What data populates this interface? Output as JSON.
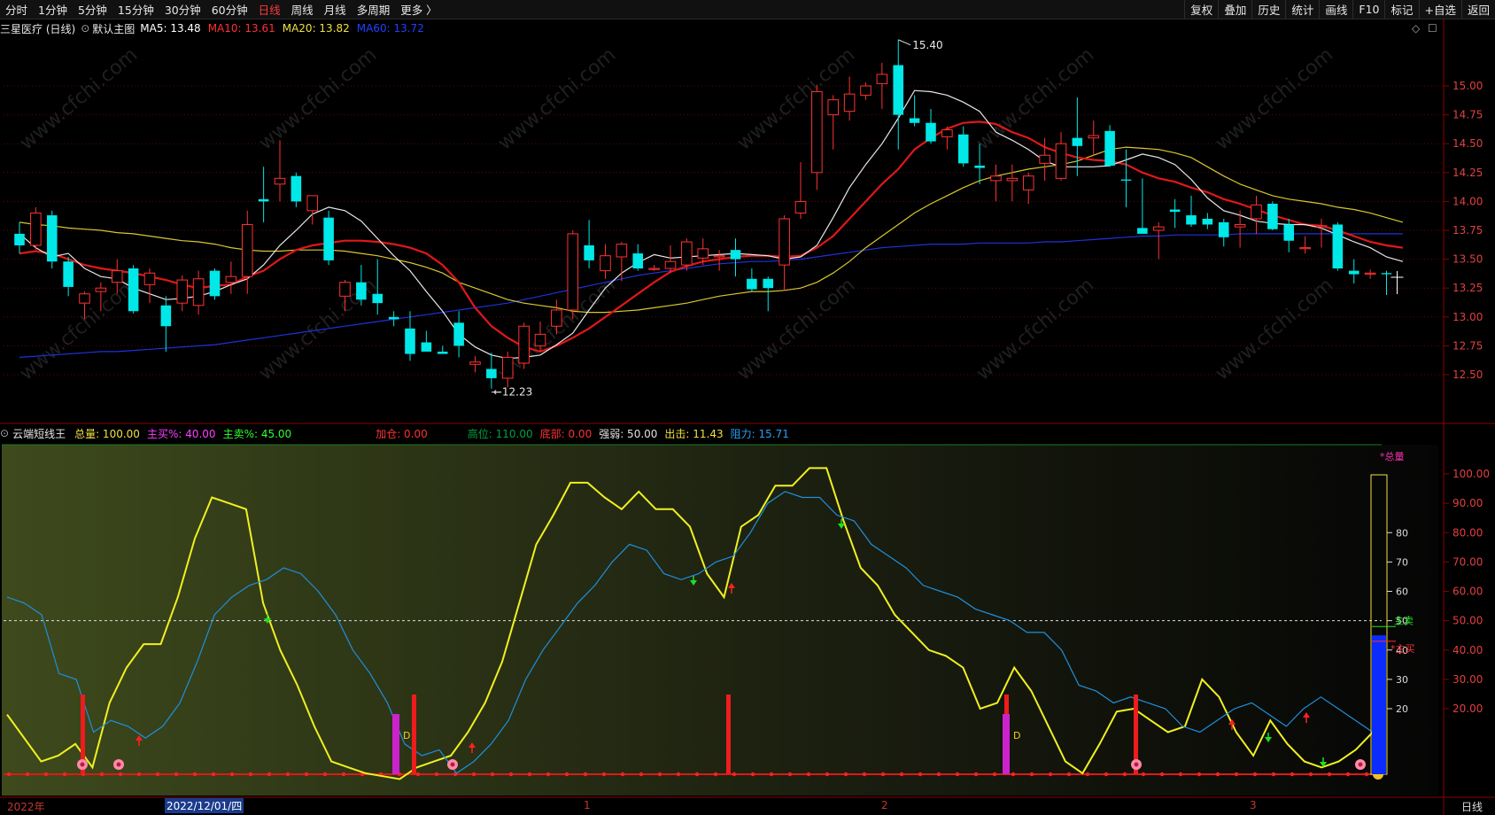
{
  "toolbar": {
    "left": [
      "分时",
      "1分钟",
      "5分钟",
      "15分钟",
      "30分钟",
      "60分钟",
      "日线",
      "周线",
      "月线",
      "多周期",
      "更多 〉"
    ],
    "active": "日线",
    "right": [
      "复权",
      "叠加",
      "历史",
      "统计",
      "画线",
      "F10",
      "标记",
      "+自选",
      "返回"
    ]
  },
  "main": {
    "stock": "三星医疗 (日线)",
    "template": "默认主图",
    "ma": [
      {
        "label": "MA5: 13.48",
        "color": "#ffffff"
      },
      {
        "label": "MA10: 13.61",
        "color": "#ff3030"
      },
      {
        "label": "MA20: 13.82",
        "color": "#f0e040"
      },
      {
        "label": "MA60: 13.72",
        "color": "#2040ff"
      }
    ],
    "high_label": "15.40",
    "low_label": "12.23",
    "price_ticks": [
      "15.00",
      "14.75",
      "14.50",
      "14.25",
      "14.00",
      "13.75",
      "13.50",
      "13.25",
      "13.00",
      "12.75",
      "12.50"
    ]
  },
  "indicator": {
    "name": "云端短线王",
    "items": [
      {
        "text": "总量: 100.00",
        "color": "#f0e040"
      },
      {
        "text": "主买%: 40.00",
        "color": "#ff3cff"
      },
      {
        "text": "主卖%: 45.00",
        "color": "#30ff30"
      },
      {
        "text": "加仓: 0.00",
        "color": "#ff3030"
      },
      {
        "text": "高位: 110.00",
        "color": "#00a040"
      },
      {
        "text": "底部: 0.00",
        "color": "#ff3030"
      },
      {
        "text": "强弱: 50.00",
        "color": "#e0e0e0"
      },
      {
        "text": "出击: 11.43",
        "color": "#f0e040"
      },
      {
        "text": "阻力: 15.71",
        "color": "#2a9df4"
      }
    ],
    "ticks": [
      "100.00",
      "90.00",
      "80.00",
      "70.00",
      "60.00",
      "50.00",
      "40.00",
      "30.00",
      "20.00"
    ],
    "bar_ticks": [
      "80",
      "70",
      "60",
      "50",
      "40",
      "30",
      "20"
    ],
    "bar_labels": {
      "total": "*总量",
      "sell": "主卖",
      "buy": "*主买"
    },
    "d_label": "D"
  },
  "dates": {
    "start": "2022年",
    "cursor": "2022/12/01/四",
    "m1": "1",
    "m2": "2",
    "m3": "3"
  },
  "period_tab": "日线",
  "watermark": "www.cfchi.com",
  "chart_data": {
    "type": "candlestick",
    "candles": [
      [
        13.72,
        13.82,
        13.55,
        13.62
      ],
      [
        13.62,
        13.95,
        13.58,
        13.9
      ],
      [
        13.88,
        13.92,
        13.42,
        13.48
      ],
      [
        13.48,
        13.52,
        13.18,
        13.26
      ],
      [
        13.12,
        13.22,
        12.98,
        13.2
      ],
      [
        13.22,
        13.3,
        13.05,
        13.25
      ],
      [
        13.3,
        13.5,
        13.2,
        13.4
      ],
      [
        13.42,
        13.45,
        13.03,
        13.05
      ],
      [
        13.28,
        13.42,
        13.12,
        13.38
      ],
      [
        13.1,
        13.18,
        12.7,
        12.92
      ],
      [
        13.12,
        13.36,
        13.05,
        13.32
      ],
      [
        13.1,
        13.4,
        13.02,
        13.33
      ],
      [
        13.4,
        13.42,
        13.15,
        13.18
      ],
      [
        13.3,
        13.48,
        13.2,
        13.35
      ],
      [
        13.35,
        13.92,
        13.2,
        13.8
      ],
      [
        14.02,
        14.3,
        13.82,
        14.0
      ],
      [
        14.15,
        14.53,
        14.0,
        14.2
      ],
      [
        14.22,
        14.25,
        13.95,
        14.0
      ],
      [
        13.92,
        14.05,
        13.8,
        14.05
      ],
      [
        13.86,
        13.92,
        13.45,
        13.49
      ],
      [
        13.18,
        13.32,
        13.05,
        13.3
      ],
      [
        13.3,
        13.45,
        13.1,
        13.15
      ],
      [
        13.2,
        13.5,
        13.02,
        13.12
      ],
      [
        13.0,
        13.05,
        12.92,
        12.98
      ],
      [
        12.9,
        13.05,
        12.62,
        12.68
      ],
      [
        12.78,
        12.88,
        12.71,
        12.7
      ],
      [
        12.7,
        12.75,
        12.69,
        12.68
      ],
      [
        12.95,
        13.05,
        12.65,
        12.75
      ],
      [
        12.59,
        12.66,
        12.52,
        12.61
      ],
      [
        12.55,
        12.69,
        12.38,
        12.47
      ],
      [
        12.47,
        12.7,
        12.39,
        12.65
      ],
      [
        12.6,
        12.95,
        12.55,
        12.92
      ],
      [
        12.75,
        12.96,
        12.7,
        12.85
      ],
      [
        12.92,
        13.15,
        12.85,
        13.06
      ],
      [
        13.06,
        13.75,
        12.98,
        13.72
      ],
      [
        13.62,
        13.84,
        13.42,
        13.49
      ],
      [
        13.4,
        13.63,
        13.33,
        13.53
      ],
      [
        13.52,
        13.65,
        13.31,
        13.63
      ],
      [
        13.55,
        13.63,
        13.4,
        13.42
      ],
      [
        13.42,
        13.45,
        13.4,
        13.42
      ],
      [
        13.42,
        13.62,
        13.38,
        13.48
      ],
      [
        13.45,
        13.68,
        13.4,
        13.65
      ],
      [
        13.51,
        13.68,
        13.45,
        13.59
      ],
      [
        13.52,
        13.58,
        13.4,
        13.53
      ],
      [
        13.58,
        13.68,
        13.35,
        13.5
      ],
      [
        13.33,
        13.42,
        13.22,
        13.24
      ],
      [
        13.33,
        13.35,
        13.05,
        13.25
      ],
      [
        13.45,
        13.88,
        13.23,
        13.85
      ],
      [
        13.9,
        14.34,
        13.85,
        14.0
      ],
      [
        14.25,
        15.01,
        14.1,
        14.95
      ],
      [
        14.75,
        14.92,
        14.45,
        14.88
      ],
      [
        14.78,
        15.08,
        14.7,
        14.93
      ],
      [
        14.92,
        15.03,
        14.88,
        15.0
      ],
      [
        15.02,
        15.2,
        14.8,
        15.1
      ],
      [
        15.18,
        15.4,
        14.45,
        14.75
      ],
      [
        14.72,
        14.92,
        14.65,
        14.68
      ],
      [
        14.68,
        14.8,
        14.5,
        14.52
      ],
      [
        14.56,
        14.65,
        14.45,
        14.62
      ],
      [
        14.58,
        14.65,
        14.3,
        14.33
      ],
      [
        14.31,
        14.5,
        14.15,
        14.29
      ],
      [
        14.18,
        14.32,
        14.0,
        14.22
      ],
      [
        14.18,
        14.32,
        14.0,
        14.2
      ],
      [
        14.1,
        14.25,
        13.98,
        14.22
      ],
      [
        14.33,
        14.55,
        14.18,
        14.4
      ],
      [
        14.2,
        14.6,
        14.18,
        14.5
      ],
      [
        14.55,
        14.9,
        14.22,
        14.48
      ],
      [
        14.55,
        14.7,
        14.4,
        14.57
      ],
      [
        14.61,
        14.66,
        14.3,
        14.31
      ],
      [
        14.19,
        14.45,
        13.95,
        14.18
      ],
      [
        13.77,
        14.2,
        13.75,
        13.72
      ],
      [
        13.75,
        13.82,
        13.5,
        13.78
      ],
      [
        13.93,
        14.02,
        13.77,
        13.91
      ],
      [
        13.88,
        14.05,
        13.78,
        13.8
      ],
      [
        13.85,
        13.9,
        13.76,
        13.8
      ],
      [
        13.82,
        13.85,
        13.61,
        13.69
      ],
      [
        13.78,
        13.92,
        13.6,
        13.8
      ],
      [
        13.85,
        14.05,
        13.72,
        13.97
      ],
      [
        13.98,
        14.0,
        13.75,
        13.76
      ],
      [
        13.8,
        13.85,
        13.56,
        13.66
      ],
      [
        13.6,
        13.7,
        13.55,
        13.6
      ],
      [
        13.78,
        13.85,
        13.6,
        13.79
      ],
      [
        13.8,
        13.82,
        13.4,
        13.42
      ],
      [
        13.4,
        13.5,
        13.29,
        13.37
      ],
      [
        13.38,
        13.41,
        13.33,
        13.38
      ],
      [
        13.38,
        13.4,
        13.19,
        13.37
      ]
    ],
    "ma5": [
      13.72,
      13.6,
      13.52,
      13.55,
      13.42,
      13.35,
      13.33,
      13.25,
      13.2,
      13.15,
      13.16,
      13.18,
      13.22,
      13.28,
      13.33,
      13.45,
      13.62,
      13.75,
      13.89,
      13.95,
      13.92,
      13.83,
      13.68,
      13.53,
      13.4,
      13.22,
      13.05,
      12.85,
      12.74,
      12.67,
      12.64,
      12.65,
      12.67,
      12.76,
      12.86,
      13.06,
      13.25,
      13.38,
      13.47,
      13.54,
      13.51,
      13.52,
      13.53,
      13.54,
      13.55,
      13.54,
      13.53,
      13.5,
      13.52,
      13.62,
      13.86,
      14.12,
      14.32,
      14.5,
      14.72,
      14.96,
      14.95,
      14.92,
      14.86,
      14.78,
      14.6,
      14.53,
      14.45,
      14.35,
      14.3,
      14.3,
      14.3,
      14.31,
      14.36,
      14.41,
      14.38,
      14.32,
      14.19,
      14.03,
      13.92,
      13.88,
      13.83,
      13.81,
      13.8,
      13.8,
      13.77,
      13.71,
      13.65,
      13.6,
      13.52,
      13.48
    ],
    "ma10": [
      13.55,
      13.57,
      13.55,
      13.5,
      13.45,
      13.42,
      13.4,
      13.38,
      13.35,
      13.32,
      13.28,
      13.25,
      13.27,
      13.28,
      13.35,
      13.4,
      13.5,
      13.58,
      13.62,
      13.64,
      13.66,
      13.66,
      13.65,
      13.63,
      13.6,
      13.55,
      13.45,
      13.3,
      13.08,
      12.92,
      12.82,
      12.74,
      12.7,
      12.75,
      12.82,
      12.9,
      13.0,
      13.1,
      13.2,
      13.3,
      13.39,
      13.44,
      13.48,
      13.5,
      13.52,
      13.53,
      13.53,
      13.52,
      13.53,
      13.6,
      13.7,
      13.85,
      14.0,
      14.15,
      14.28,
      14.45,
      14.55,
      14.63,
      14.68,
      14.69,
      14.67,
      14.6,
      14.55,
      14.47,
      14.42,
      14.38,
      14.36,
      14.35,
      14.32,
      14.25,
      14.2,
      14.17,
      14.12,
      14.08,
      14.02,
      13.98,
      13.93,
      13.88,
      13.84,
      13.8,
      13.79,
      13.75,
      13.7,
      13.65,
      13.62,
      13.6
    ],
    "ma20": [
      13.82,
      13.8,
      13.79,
      13.77,
      13.76,
      13.75,
      13.73,
      13.72,
      13.7,
      13.68,
      13.66,
      13.65,
      13.63,
      13.6,
      13.58,
      13.57,
      13.57,
      13.58,
      13.58,
      13.58,
      13.57,
      13.55,
      13.53,
      13.5,
      13.47,
      13.43,
      13.38,
      13.3,
      13.25,
      13.2,
      13.15,
      13.12,
      13.1,
      13.08,
      13.05,
      13.04,
      13.04,
      13.05,
      13.06,
      13.08,
      13.1,
      13.12,
      13.15,
      13.18,
      13.2,
      13.22,
      13.22,
      13.23,
      13.25,
      13.3,
      13.38,
      13.48,
      13.6,
      13.7,
      13.8,
      13.9,
      13.98,
      14.05,
      14.12,
      14.18,
      14.22,
      14.25,
      14.28,
      14.3,
      14.32,
      14.35,
      14.4,
      14.45,
      14.47,
      14.46,
      14.45,
      14.42,
      14.38,
      14.3,
      14.22,
      14.15,
      14.1,
      14.05,
      14.02,
      14.0,
      13.98,
      13.95,
      13.93,
      13.9,
      13.86,
      13.82
    ],
    "ma60": [
      12.65,
      12.66,
      12.67,
      12.68,
      12.69,
      12.7,
      12.7,
      12.71,
      12.72,
      12.73,
      12.74,
      12.75,
      12.76,
      12.78,
      12.8,
      12.82,
      12.84,
      12.86,
      12.88,
      12.9,
      12.92,
      12.94,
      12.96,
      12.98,
      13.0,
      13.02,
      13.04,
      13.06,
      13.08,
      13.1,
      13.12,
      13.15,
      13.18,
      13.21,
      13.24,
      13.27,
      13.3,
      13.33,
      13.36,
      13.38,
      13.4,
      13.42,
      13.44,
      13.46,
      13.47,
      13.48,
      13.48,
      13.49,
      13.5,
      13.52,
      13.54,
      13.56,
      13.58,
      13.6,
      13.61,
      13.62,
      13.63,
      13.63,
      13.63,
      13.64,
      13.64,
      13.64,
      13.64,
      13.65,
      13.65,
      13.66,
      13.67,
      13.68,
      13.69,
      13.7,
      13.7,
      13.71,
      13.71,
      13.71,
      13.71,
      13.72,
      13.72,
      13.72,
      13.72,
      13.72,
      13.72,
      13.72,
      13.72,
      13.72,
      13.72,
      13.72
    ],
    "indicator_yellow": [
      18,
      10,
      2,
      4,
      8,
      0,
      22,
      34,
      42,
      42,
      58,
      78,
      92,
      90,
      88,
      56,
      40,
      28,
      14,
      2,
      0,
      -2,
      -3,
      -4,
      0,
      2,
      4,
      12,
      22,
      36,
      56,
      76,
      86,
      97,
      97,
      92,
      88,
      94,
      88,
      88,
      82,
      66,
      58,
      82,
      86,
      96,
      96,
      102,
      102,
      84,
      68,
      62,
      52,
      46,
      40,
      38,
      34,
      20,
      22,
      34,
      26,
      14,
      2,
      -2,
      8,
      19,
      20,
      16,
      12,
      14,
      30,
      24,
      12,
      4,
      16,
      8,
      2,
      0,
      2,
      6,
      12
    ],
    "indicator_blue": [
      58,
      56,
      52,
      32,
      30,
      12,
      16,
      14,
      10,
      14,
      22,
      36,
      52,
      58,
      62,
      64,
      68,
      66,
      60,
      52,
      40,
      32,
      22,
      8,
      4,
      6,
      -2,
      2,
      8,
      16,
      30,
      40,
      48,
      56,
      62,
      70,
      76,
      74,
      66,
      64,
      66,
      70,
      72,
      80,
      90,
      94,
      92,
      92,
      86,
      84,
      76,
      72,
      68,
      62,
      60,
      58,
      54,
      52,
      50,
      46,
      46,
      40,
      28,
      26,
      22,
      24,
      22,
      20,
      14,
      12,
      16,
      20,
      22,
      18,
      14,
      20,
      24,
      20,
      16,
      12
    ],
    "ylim_indicator": [
      -5,
      102
    ]
  }
}
